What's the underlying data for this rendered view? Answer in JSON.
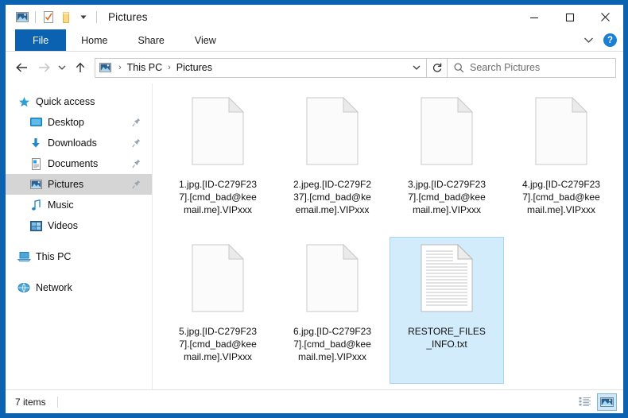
{
  "window": {
    "title": "Pictures",
    "frame_color": "#0a62b0",
    "quick_access": [
      {
        "name": "pictures-icon",
        "label": "Pictures"
      },
      {
        "name": "properties-icon",
        "label": "Properties"
      },
      {
        "name": "new-folder-icon",
        "label": "New folder"
      },
      {
        "name": "customize-chevron-icon",
        "label": "Customize Quick Access Toolbar"
      }
    ],
    "controls": {
      "minimize": "–",
      "maximize": "□",
      "close": "✕"
    }
  },
  "ribbon": {
    "tabs": [
      {
        "label": "File",
        "active": true
      },
      {
        "label": "Home",
        "active": false
      },
      {
        "label": "Share",
        "active": false
      },
      {
        "label": "View",
        "active": false
      }
    ],
    "collapse_icon": "chevron-down-icon",
    "help_label": "?"
  },
  "address": {
    "back_tooltip": "Back",
    "forward_tooltip": "Forward",
    "recent_tooltip": "Recent locations",
    "up_tooltip": "Up",
    "breadcrumb": [
      {
        "label": "This PC"
      },
      {
        "label": "Pictures"
      }
    ],
    "separator": "›",
    "refresh_tooltip": "Refresh"
  },
  "search": {
    "placeholder": "Search Pictures",
    "value": ""
  },
  "sidebar": {
    "items": [
      {
        "label": "Quick access",
        "icon": "star-icon",
        "indent": false,
        "pinned": false,
        "selected": false
      },
      {
        "label": "Desktop",
        "icon": "desktop-icon",
        "indent": true,
        "pinned": true,
        "selected": false
      },
      {
        "label": "Downloads",
        "icon": "downloads-icon",
        "indent": true,
        "pinned": true,
        "selected": false
      },
      {
        "label": "Documents",
        "icon": "documents-icon",
        "indent": true,
        "pinned": true,
        "selected": false
      },
      {
        "label": "Pictures",
        "icon": "pictures-icon",
        "indent": true,
        "pinned": true,
        "selected": true
      },
      {
        "label": "Music",
        "icon": "music-icon",
        "indent": true,
        "pinned": false,
        "selected": false
      },
      {
        "label": "Videos",
        "icon": "videos-icon",
        "indent": true,
        "pinned": false,
        "selected": false
      },
      {
        "label": "This PC",
        "icon": "this-pc-icon",
        "indent": false,
        "pinned": false,
        "selected": false,
        "gap_before": true
      },
      {
        "label": "Network",
        "icon": "network-icon",
        "indent": false,
        "pinned": false,
        "selected": false,
        "gap_before": true
      }
    ]
  },
  "files": [
    {
      "name": "1.jpg.[ID-C279F237].[cmd_bad@keemail.me].VIPxxx",
      "icon": "blank-file-icon",
      "selected": false
    },
    {
      "name": "2.jpeg.[ID-C279F237].[cmd_bad@keemail.me].VIPxxx",
      "icon": "blank-file-icon",
      "selected": false
    },
    {
      "name": "3.jpg.[ID-C279F237].[cmd_bad@keemail.me].VIPxxx",
      "icon": "blank-file-icon",
      "selected": false
    },
    {
      "name": "4.jpg.[ID-C279F237].[cmd_bad@keemail.me].VIPxxx",
      "icon": "blank-file-icon",
      "selected": false
    },
    {
      "name": "5.jpg.[ID-C279F237].[cmd_bad@keemail.me].VIPxxx",
      "icon": "blank-file-icon",
      "selected": false
    },
    {
      "name": "6.jpg.[ID-C279F237].[cmd_bad@keemail.me].VIPxxx",
      "icon": "blank-file-icon",
      "selected": false
    },
    {
      "name": "RESTORE_FILES_INFO.txt",
      "icon": "text-file-icon",
      "selected": true
    }
  ],
  "statusbar": {
    "item_count": "7 items",
    "views": [
      {
        "name": "details-view-button",
        "active": false
      },
      {
        "name": "large-icons-view-button",
        "active": true
      }
    ]
  }
}
